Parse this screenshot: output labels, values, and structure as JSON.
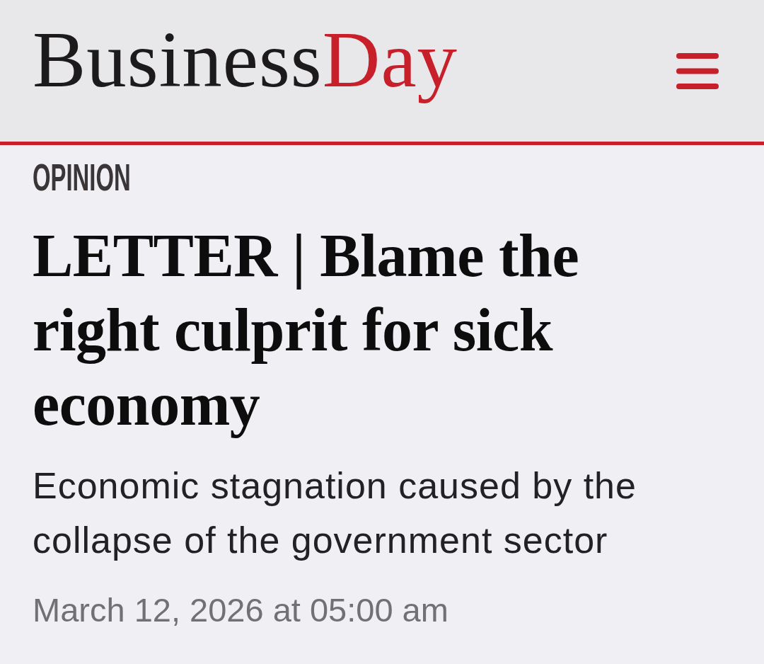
{
  "header": {
    "logo": [
      {
        "text": "Business",
        "color": "#1c1a1b"
      },
      {
        "text": "Day",
        "color": "#c8202a"
      }
    ]
  },
  "article": {
    "section": "OPINION",
    "headline": "LETTER | Blame the right culprit for sick economy",
    "standfirst": "Economic stagnation caused by the collapse of the government sector",
    "date": "March 12, 2026 at 05:00 am"
  }
}
